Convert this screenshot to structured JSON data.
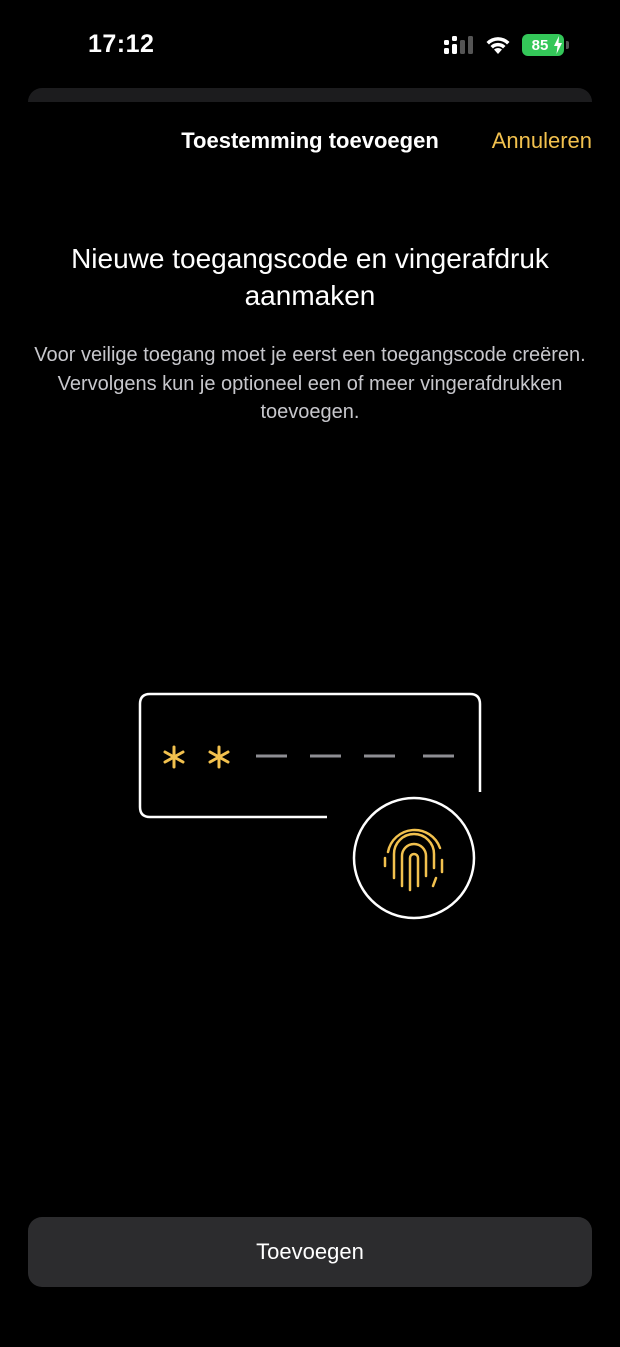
{
  "status_bar": {
    "time": "17:12",
    "battery_level": "85",
    "icons": [
      "signal-icon",
      "wifi-icon",
      "battery-icon"
    ]
  },
  "nav": {
    "title": "Toestemming toevoegen",
    "cancel_label": "Annuleren"
  },
  "content": {
    "heading": "Nieuwe toegangscode en vingerafdruk aanmaken",
    "description": "Voor veilige toegang moet je eerst een toegangscode creëren. Vervolgens kun je optioneel een of meer vingerafdrukken toevoegen."
  },
  "illustration": {
    "entered_symbols": [
      "*",
      "*"
    ],
    "empty_slots": 4,
    "icons": [
      "passcode-field-icon",
      "fingerprint-icon"
    ]
  },
  "footer": {
    "add_label": "Toevoegen"
  },
  "colors": {
    "background": "#000000",
    "accent": "#f2c14e",
    "button_bg": "#2c2c2e",
    "battery": "#34c759"
  }
}
